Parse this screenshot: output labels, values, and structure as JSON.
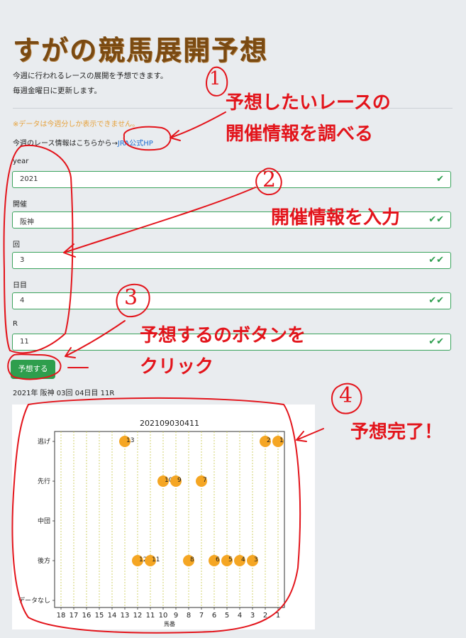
{
  "title": "すがの競馬展開予想",
  "intro": [
    "今週に行われるレースの展開を予想できます。",
    "毎週金曜日に更新します。"
  ],
  "warning": "※データは今週分しか表示できません。",
  "info": {
    "text": "今週のレース情報はこちらから→",
    "link": "JRA公式HP"
  },
  "form": {
    "year": {
      "label": "year",
      "value": "2021"
    },
    "kaisai": {
      "label": "開催",
      "value": "阪神"
    },
    "kai": {
      "label": "回",
      "value": "3"
    },
    "nichime": {
      "label": "日目",
      "value": "4"
    },
    "race": {
      "label": "R",
      "value": "11"
    },
    "submit_label": "予想する"
  },
  "result_text": "2021年 阪神 03回 04日目 11R",
  "chart_data": {
    "type": "scatter",
    "title": "202109030411",
    "xlabel": "馬番",
    "ylabel": "",
    "x_ticks": [
      "18",
      "17",
      "16",
      "15",
      "14",
      "13",
      "12",
      "11",
      "10",
      "9",
      "8",
      "7",
      "6",
      "5",
      "4",
      "3",
      "2",
      "1"
    ],
    "y_categories": [
      "データなし",
      "後方",
      "中団",
      "先行",
      "逃げ"
    ],
    "x_reversed": true,
    "grid": "vertical dotted",
    "marker_color": "#f5a623",
    "points": [
      {
        "horse": 13,
        "position": "逃げ"
      },
      {
        "horse": 2,
        "position": "逃げ"
      },
      {
        "horse": 1,
        "position": "逃げ"
      },
      {
        "horse": 10,
        "position": "先行"
      },
      {
        "horse": 9,
        "position": "先行"
      },
      {
        "horse": 7,
        "position": "先行"
      },
      {
        "horse": 12,
        "position": "後方"
      },
      {
        "horse": 11,
        "position": "後方"
      },
      {
        "horse": 8,
        "position": "後方"
      },
      {
        "horse": 6,
        "position": "後方"
      },
      {
        "horse": 5,
        "position": "後方"
      },
      {
        "horse": 4,
        "position": "後方"
      },
      {
        "horse": 3,
        "position": "後方"
      }
    ]
  },
  "annotations": {
    "num1": "1",
    "step1": [
      "予想したいレースの",
      "開催情報を調べる"
    ],
    "num2": "2",
    "step2": "開催情報を入力",
    "num3": "3",
    "step3": [
      "予想するのボタンを",
      "クリック"
    ],
    "num4": "4",
    "step4": "予想完了！",
    "color": "#e3141b"
  }
}
